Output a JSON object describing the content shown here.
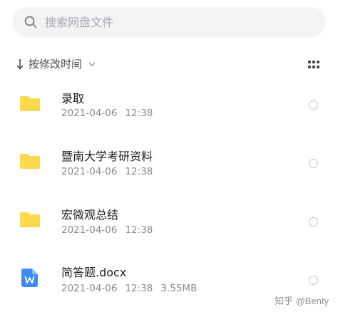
{
  "search": {
    "placeholder": "搜索网盘文件"
  },
  "sort": {
    "label": "按修改时间"
  },
  "files": [
    {
      "name": "录取",
      "date": "2021-04-06",
      "time": "12:38",
      "type": "folder"
    },
    {
      "name": "暨南大学考研资料",
      "date": "2021-04-06",
      "time": "12:38",
      "type": "folder"
    },
    {
      "name": "宏微观总结",
      "date": "2021-04-06",
      "time": "12:38",
      "type": "folder"
    },
    {
      "name": "简答题.docx",
      "date": "2021-04-06",
      "time": "12:38",
      "size": "3.55MB",
      "type": "word-document"
    }
  ],
  "watermark": "知乎 @Benty",
  "colors": {
    "folder": "#fdd94f",
    "word": "#3d8cf2",
    "search_bg": "#f3f4f6"
  }
}
